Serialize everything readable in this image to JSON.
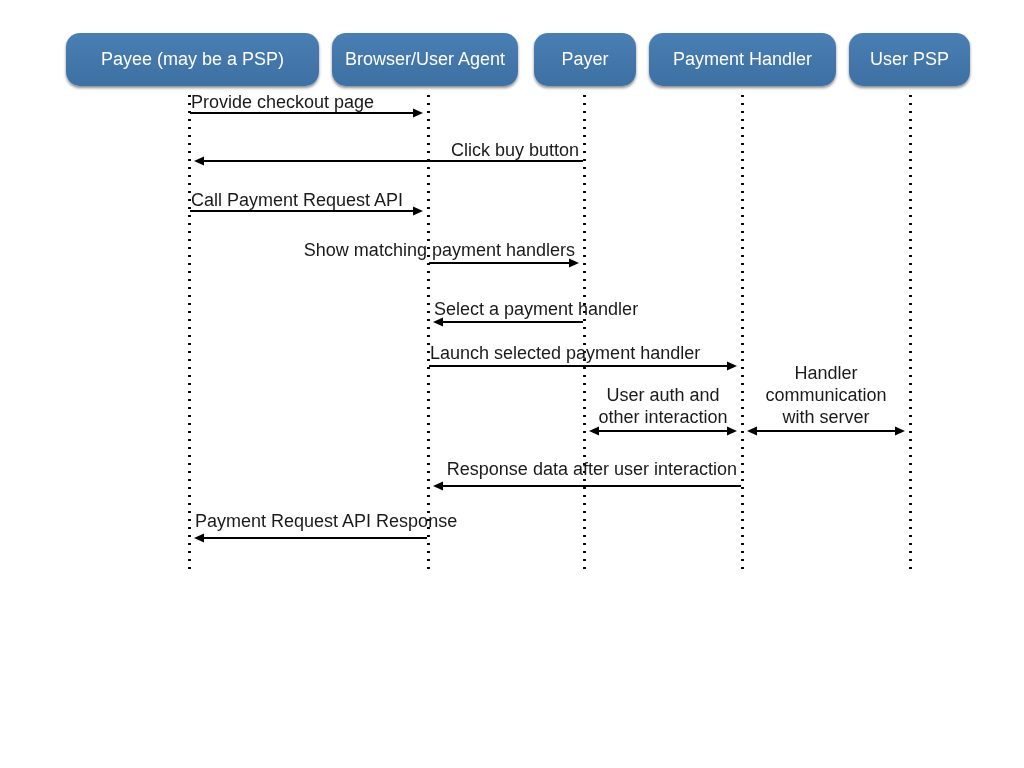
{
  "participants": [
    {
      "label": "Payee (may be a PSP)"
    },
    {
      "label": "Browser/User Agent"
    },
    {
      "label": "Payer"
    },
    {
      "label": "Payment Handler"
    },
    {
      "label": "User PSP"
    }
  ],
  "messages": [
    {
      "label": "Provide checkout page",
      "lanes": [
        {
          "kind": "tail"
        },
        {
          "kind": "head"
        },
        {
          "kind": "none"
        },
        {
          "kind": "none"
        },
        {
          "kind": "none"
        }
      ]
    },
    {
      "label": "Click buy button",
      "lanes": [
        {
          "kind": "head"
        },
        {
          "kind": "none"
        },
        {
          "kind": "tail"
        },
        {
          "kind": "none"
        },
        {
          "kind": "none"
        }
      ]
    },
    {
      "label": "Call Payment Request API",
      "lanes": [
        {
          "kind": "tail"
        },
        {
          "kind": "head"
        },
        {
          "kind": "none"
        },
        {
          "kind": "none"
        },
        {
          "kind": "none"
        }
      ]
    },
    {
      "label": "Show matching payment handlers",
      "lanes": [
        {
          "kind": "none"
        },
        {
          "kind": "tail"
        },
        {
          "kind": "head"
        },
        {
          "kind": "none"
        },
        {
          "kind": "none"
        }
      ]
    },
    {
      "label": "Select a payment handler",
      "lanes": [
        {
          "kind": "none"
        },
        {
          "kind": "head"
        },
        {
          "kind": "tail"
        },
        {
          "kind": "none"
        },
        {
          "kind": "none"
        }
      ]
    },
    {
      "label": "Launch selected payment handler",
      "lanes": [
        {
          "kind": "none"
        },
        {
          "kind": "tail"
        },
        {
          "kind": "none"
        },
        {
          "kind": "head"
        },
        {
          "kind": "none"
        }
      ]
    },
    {
      "label": "User auth and\nother interaction",
      "lanes": [
        {
          "kind": "none"
        },
        {
          "kind": "none"
        },
        {
          "kind": "head"
        },
        {
          "kind": "head"
        },
        {
          "kind": "none"
        }
      ]
    },
    {
      "label": "Handler\ncommunication\nwith server",
      "lanes": [
        {
          "kind": "none"
        },
        {
          "kind": "none"
        },
        {
          "kind": "none"
        },
        {
          "kind": "head"
        },
        {
          "kind": "head"
        }
      ]
    },
    {
      "label": "Response data after user interaction",
      "lanes": [
        {
          "kind": "none"
        },
        {
          "kind": "head"
        },
        {
          "kind": "none"
        },
        {
          "kind": "tail"
        },
        {
          "kind": "none"
        }
      ]
    },
    {
      "label": "Payment Request API Response",
      "lanes": [
        {
          "kind": "head"
        },
        {
          "kind": "tail"
        },
        {
          "kind": "none"
        },
        {
          "kind": "none"
        },
        {
          "kind": "none"
        }
      ]
    }
  ]
}
